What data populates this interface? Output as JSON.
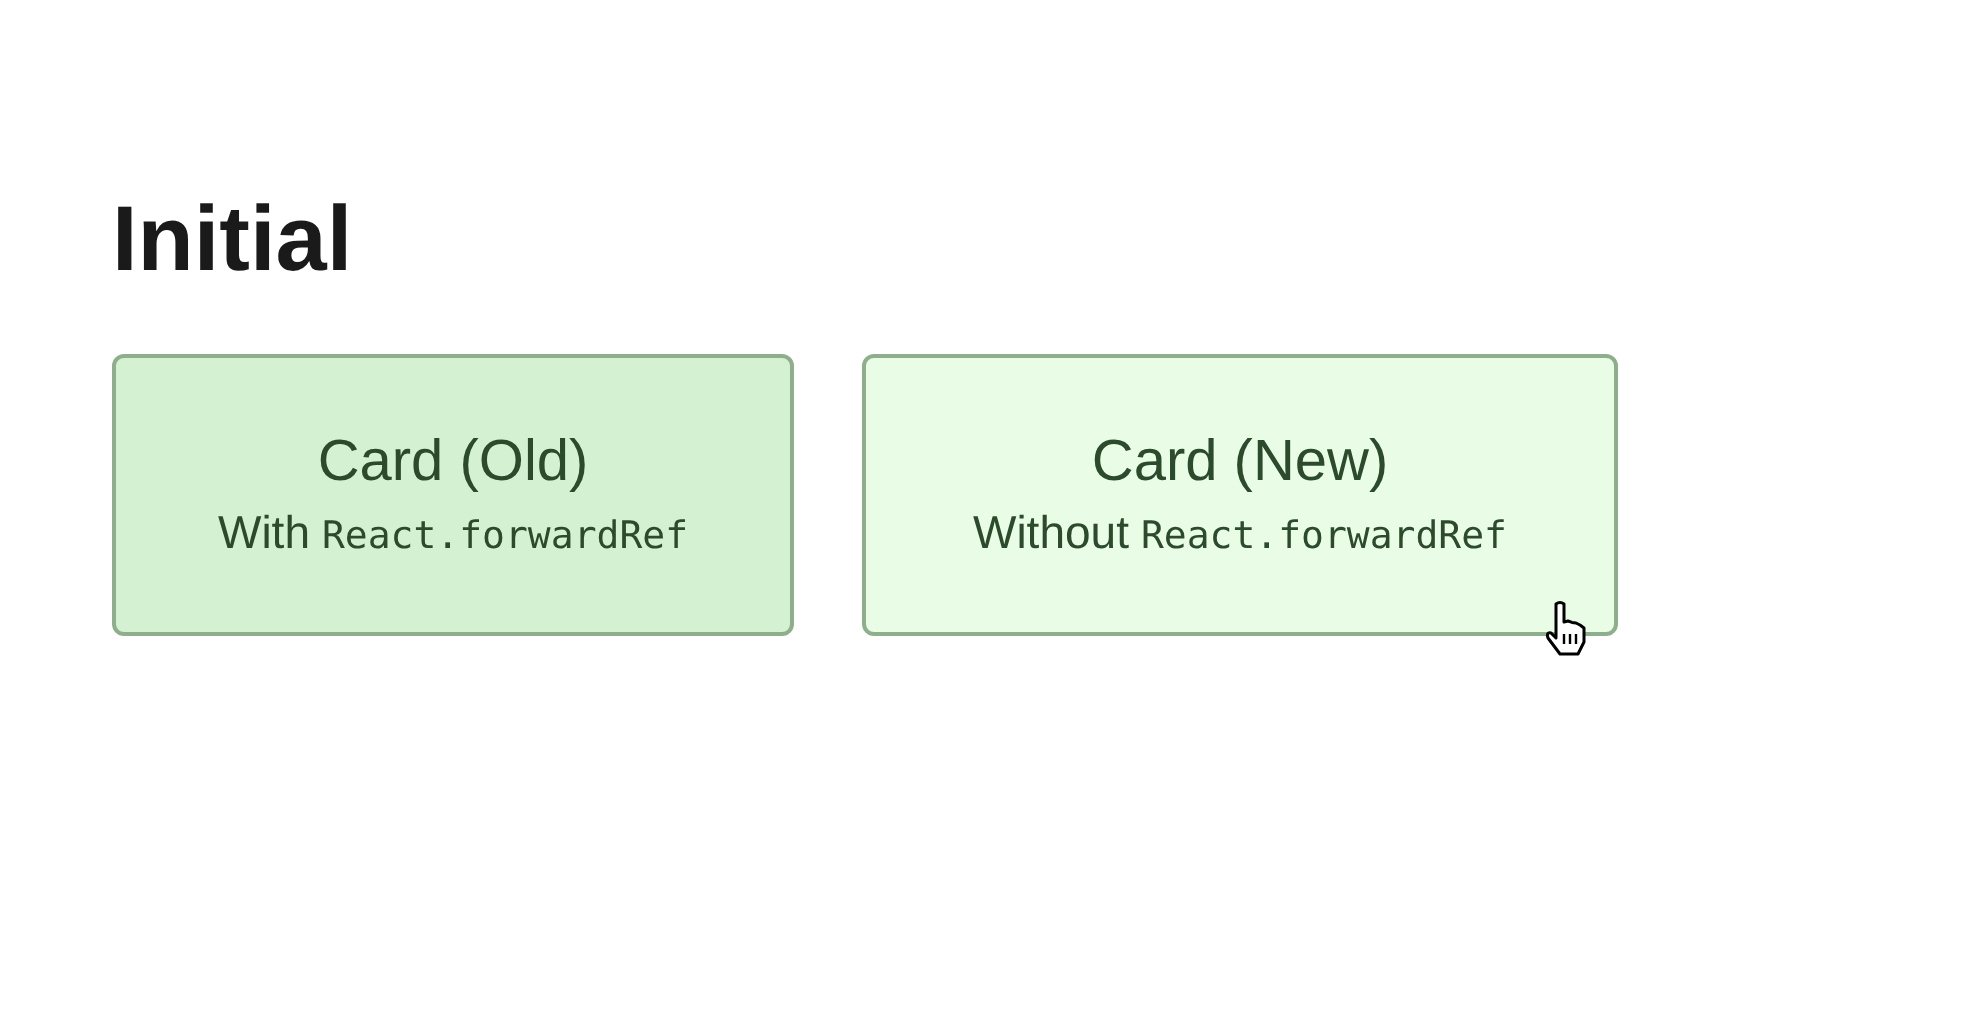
{
  "heading": "Initial",
  "cards": [
    {
      "title": "Card (Old)",
      "text": "With",
      "code": "React.forwardRef",
      "color": "#d4f2d2",
      "pointer": false
    },
    {
      "title": "Card (New)",
      "text": "Without",
      "code": "React.forwardRef",
      "color": "#e8fce6",
      "pointer": true
    }
  ]
}
